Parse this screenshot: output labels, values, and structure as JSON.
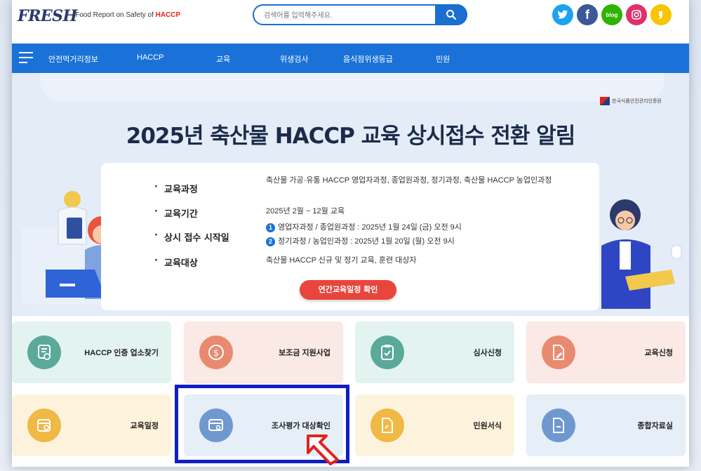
{
  "header": {
    "logo": "FRESH",
    "tagline_prefix": "· Food Report on Safety of ",
    "tagline_brand": "HACCP",
    "search_placeholder": "검색어를 입력해주세요.",
    "socials": [
      {
        "name": "twitter-icon",
        "glyph": "🐦",
        "color": "#1da1f2"
      },
      {
        "name": "facebook-icon",
        "glyph": "f",
        "color": "#3b5998"
      },
      {
        "name": "blog-icon",
        "glyph": "blog",
        "color": "#2db400"
      },
      {
        "name": "instagram-icon",
        "glyph": "◎",
        "color": "#e1306c"
      },
      {
        "name": "kakao-icon",
        "glyph": "❜",
        "color": "#f7c600"
      }
    ]
  },
  "nav": {
    "items": [
      "안전먹거리정보",
      "HACCP",
      "교육",
      "위생검사",
      "음식점위생등급",
      "민원"
    ]
  },
  "banner": {
    "org": "한국식품안전관리인증원",
    "title": "2025년 축산물 HACCP 교육 상시접수 전환 알림",
    "rows": [
      {
        "label": "교육과정",
        "value": "축산물 가공·유통 HACCP 영업자과정, 종업원과정, 정기과정, 축산물 HACCP 농업인과정"
      },
      {
        "label": "교육기간",
        "value": "2025년 2월 ~ 12월 교육"
      },
      {
        "label": "상시 접수 시작일",
        "value1": "영업자과정 / 종업원과정 : 2025년 1월 24일 (금) 오전 9시",
        "value2": "정기과정 / 농업인과정 : 2025년 1월 20일 (월) 오전 9시"
      },
      {
        "label": "교육대상",
        "value": "축산물 HACCP 신규 및 정기 교육, 훈련 대상자"
      }
    ],
    "cta": "연간교육일정 확인"
  },
  "tiles": [
    {
      "label": "HACCP 인증 업소찾기",
      "icon": "badge-check-icon",
      "bg": "#e3f3f0",
      "circle": "#5aa99a"
    },
    {
      "label": "보조금 지원사업",
      "icon": "dollar-icon",
      "bg": "#fbe9e5",
      "circle": "#e88a70"
    },
    {
      "label": "심사신청",
      "icon": "clipboard-check-icon",
      "bg": "#e3f3f0",
      "circle": "#5aa99a"
    },
    {
      "label": "교육신청",
      "icon": "document-edit-icon",
      "bg": "#fbe9e5",
      "circle": "#e88a70"
    },
    {
      "label": "교육일정",
      "icon": "calendar-search-icon",
      "bg": "#fdf3dc",
      "circle": "#f0b945"
    },
    {
      "label": "조사평가 대상확인",
      "icon": "card-search-icon",
      "bg": "#e6eef8",
      "circle": "#6f98cf"
    },
    {
      "label": "민원서식",
      "icon": "document-icon",
      "bg": "#fdf3dc",
      "circle": "#f0b945"
    },
    {
      "label": "종합자료실",
      "icon": "folder-icon",
      "bg": "#e6eef8",
      "circle": "#6f98cf"
    }
  ]
}
